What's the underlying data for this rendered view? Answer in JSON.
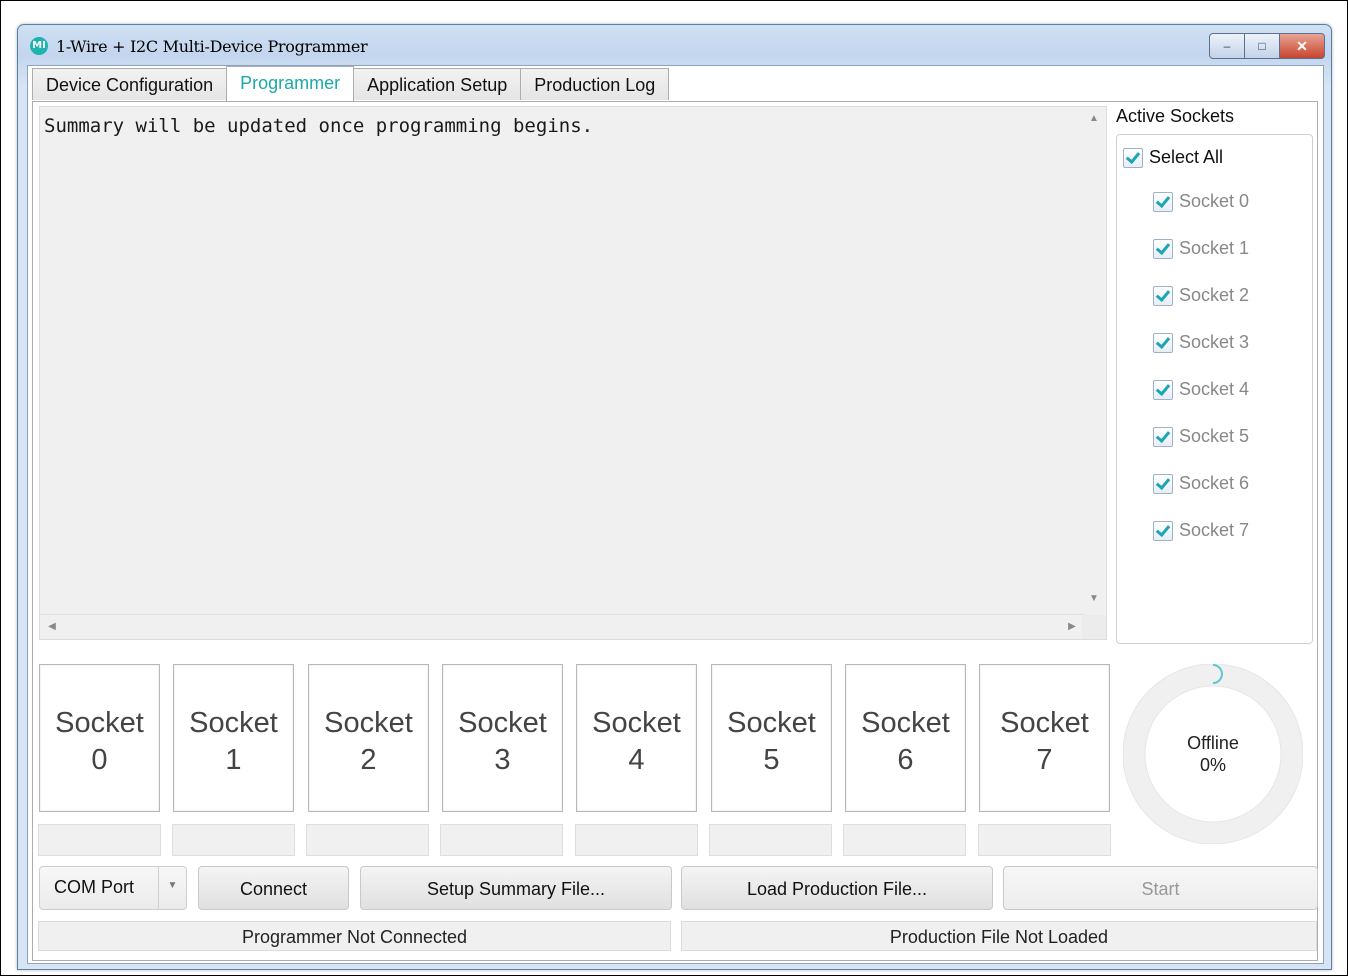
{
  "window": {
    "title": "1-Wire + I2C Multi-Device Programmer",
    "icon": "maxim-logo-icon",
    "controls": {
      "minimize": "–",
      "maximize": "□",
      "close": "✕"
    }
  },
  "tabs": [
    {
      "label": "Device Configuration",
      "active": false
    },
    {
      "label": "Programmer",
      "active": true
    },
    {
      "label": "Application Setup",
      "active": false
    },
    {
      "label": "Production Log",
      "active": false
    }
  ],
  "summary": {
    "text": "Summary will be updated once programming begins."
  },
  "active_sockets": {
    "title": "Active Sockets",
    "select_all": {
      "label": "Select All",
      "checked": true
    },
    "items": [
      {
        "label": "Socket 0",
        "checked": true
      },
      {
        "label": "Socket 1",
        "checked": true
      },
      {
        "label": "Socket 2",
        "checked": true
      },
      {
        "label": "Socket 3",
        "checked": true
      },
      {
        "label": "Socket 4",
        "checked": true
      },
      {
        "label": "Socket 5",
        "checked": true
      },
      {
        "label": "Socket 6",
        "checked": true
      },
      {
        "label": "Socket 7",
        "checked": true
      }
    ]
  },
  "socket_cards": [
    {
      "name": "Socket",
      "number": "0"
    },
    {
      "name": "Socket",
      "number": "1"
    },
    {
      "name": "Socket",
      "number": "2"
    },
    {
      "name": "Socket",
      "number": "3"
    },
    {
      "name": "Socket",
      "number": "4"
    },
    {
      "name": "Socket",
      "number": "5"
    },
    {
      "name": "Socket",
      "number": "6"
    },
    {
      "name": "Socket",
      "number": "7"
    }
  ],
  "progress": {
    "state": "Offline",
    "percent_label": "0%",
    "percent": 0,
    "accent_color": "#5fc7d6"
  },
  "controls": {
    "com_port": "COM Port",
    "connect": "Connect",
    "setup_summary": "Setup Summary File...",
    "load_production": "Load Production File...",
    "start": "Start"
  },
  "status": {
    "programmer": "Programmer Not Connected",
    "production_file": "Production File Not Loaded"
  },
  "colors": {
    "accent": "#1ba9a8",
    "checkmark": "#1aa6b7"
  }
}
